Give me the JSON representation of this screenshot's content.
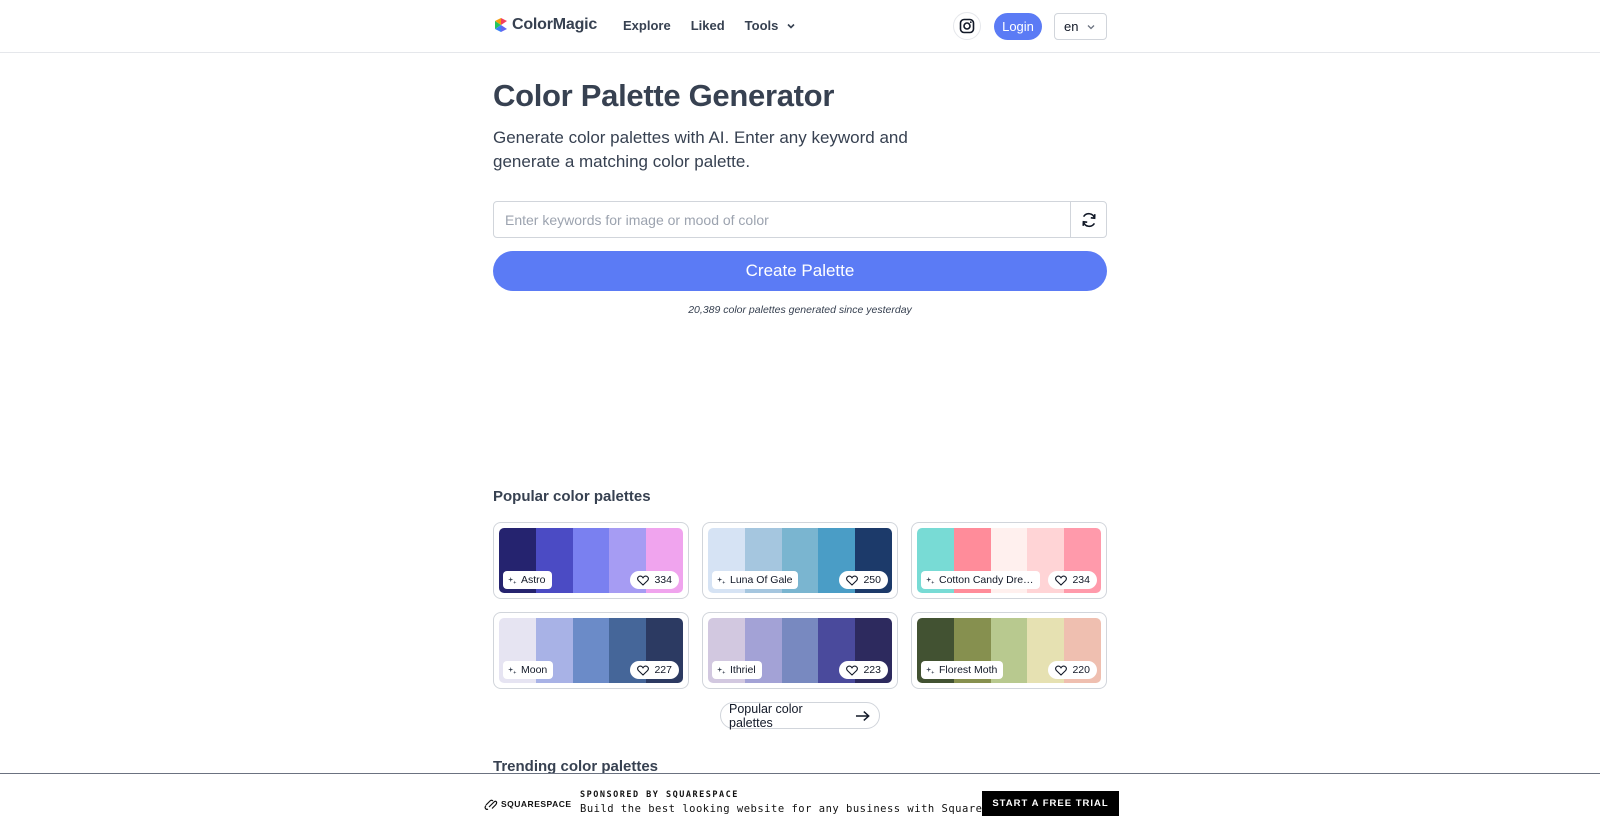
{
  "header": {
    "brand": "ColorMagic",
    "nav": {
      "explore": "Explore",
      "liked": "Liked",
      "tools": "Tools"
    },
    "login": "Login",
    "language": "en"
  },
  "hero": {
    "title": "Color Palette Generator",
    "subtitle": "Generate color palettes with AI. Enter any keyword and generate a matching color palette.",
    "search_placeholder": "Enter keywords for image or mood of color",
    "search_value": "",
    "create_button": "Create Palette",
    "stat": "20,389 color palettes generated since yesterday"
  },
  "popular": {
    "title": "Popular color palettes",
    "more_button": "Popular color palettes",
    "palettes": [
      {
        "name": "Astro",
        "likes": "334",
        "colors": [
          "#25236f",
          "#4b4bc4",
          "#7a80f0",
          "#a69cf3",
          "#f0a4ee"
        ]
      },
      {
        "name": "Luna Of Gale",
        "likes": "250",
        "colors": [
          "#d6e3f4",
          "#a5c6df",
          "#7ab5d0",
          "#4a9dc6",
          "#1c3a6a"
        ]
      },
      {
        "name": "Cotton Candy Dre…",
        "likes": "234",
        "colors": [
          "#78dbd5",
          "#ff8c9a",
          "#fff0ee",
          "#ffd4d6",
          "#ff9aab"
        ]
      },
      {
        "name": "Moon",
        "likes": "227",
        "colors": [
          "#e6e4f2",
          "#a8b2e6",
          "#6b8bc8",
          "#456699",
          "#2c3a62"
        ]
      },
      {
        "name": "Ithriel",
        "likes": "223",
        "colors": [
          "#d2c8e0",
          "#a3a2d6",
          "#7889c0",
          "#4a4a9c",
          "#2d2a5e"
        ]
      },
      {
        "name": "Florest Moth",
        "likes": "220",
        "colors": [
          "#425232",
          "#86904f",
          "#b8c98f",
          "#e6e1b2",
          "#efbfb0"
        ]
      }
    ]
  },
  "trending": {
    "title": "Trending color palettes"
  },
  "sponsor": {
    "brand": "SQUARESPACE",
    "label": "SPONSORED BY SQUARESPACE",
    "text": "Build the best looking website for any business with Squarespace.",
    "cta": "START A FREE TRIAL"
  },
  "icons": {
    "logo": "colormagic-logo-icon",
    "tools": "chevron-down-icon",
    "instagram": "instagram-icon",
    "language": "chevron-down-icon",
    "refresh": "refresh-icon",
    "palette_tag": "sparkle-icon",
    "likes": "heart-icon",
    "more": "arrow-right-icon",
    "sponsor": "squarespace-logo-icon"
  }
}
